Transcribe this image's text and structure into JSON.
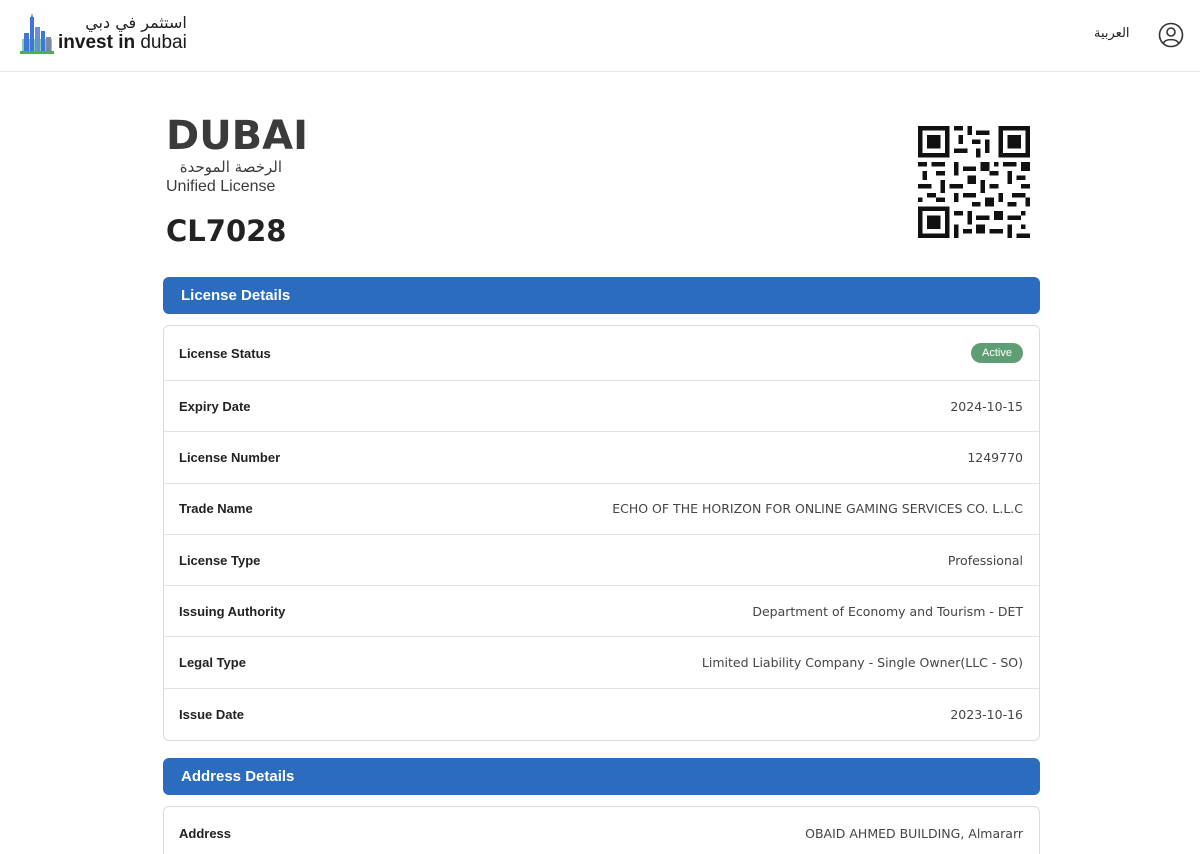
{
  "header": {
    "brand_ar": "استثمر في دبي",
    "brand_en_bold": "invest in",
    "brand_en_light": " dubai",
    "language_label": "العربية",
    "colors": {
      "skyline_blue": "#3f74d8",
      "skyline_green": "#4caf50",
      "skyline_grey": "#7a8aa0"
    }
  },
  "license": {
    "logo_word": "DUBAI",
    "logo_ar": "الرخصة الموحدة",
    "logo_en": "Unified License",
    "code": "CL7028"
  },
  "license_details": {
    "title": "License Details",
    "rows": [
      {
        "label": "License Status",
        "value": "Active",
        "badge": true
      },
      {
        "label": "Expiry Date",
        "value": "2024-10-15"
      },
      {
        "label": "License Number",
        "value": "1249770"
      },
      {
        "label": "Trade Name",
        "value": "ECHO OF THE HORIZON FOR ONLINE GAMING SERVICES CO. L.L.C"
      },
      {
        "label": "License Type",
        "value": "Professional"
      },
      {
        "label": "Issuing Authority",
        "value": "Department of Economy and Tourism - DET"
      },
      {
        "label": "Legal Type",
        "value": "Limited Liability Company - Single Owner(LLC - SO)"
      },
      {
        "label": "Issue Date",
        "value": "2023-10-16"
      }
    ]
  },
  "address_details": {
    "title": "Address Details",
    "rows": [
      {
        "label": "Address",
        "value": "OBAID AHMED BUILDING, Almararr"
      }
    ]
  },
  "colors": {
    "primary": "#2b6cbf",
    "status_active": "#5f9e74"
  },
  "icons": {
    "user": "user-circle-icon",
    "qr": "qr-code-icon"
  }
}
